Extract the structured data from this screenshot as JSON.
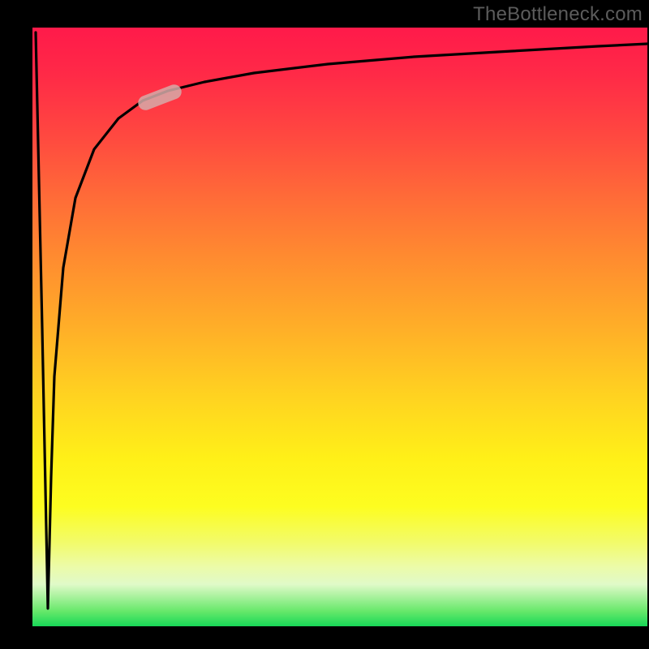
{
  "watermark": "TheBottleneck.com",
  "chart_data": {
    "type": "line",
    "title": "",
    "xlabel": "",
    "ylabel": "",
    "x_range": [
      0,
      100
    ],
    "y_range": [
      0,
      100
    ],
    "grid": false,
    "background_gradient": {
      "stops": [
        {
          "pos": 0.0,
          "color": "#ff1a4a"
        },
        {
          "pos": 0.18,
          "color": "#ff4840"
        },
        {
          "pos": 0.38,
          "color": "#ff8a30"
        },
        {
          "pos": 0.62,
          "color": "#ffd420"
        },
        {
          "pos": 0.8,
          "color": "#fdfd20"
        },
        {
          "pos": 0.93,
          "color": "#e0fac8"
        },
        {
          "pos": 1.0,
          "color": "#18d858"
        }
      ]
    },
    "series": [
      {
        "name": "bottleneck-curve",
        "x": [
          0.5,
          1.5,
          2.5,
          3.0,
          3.5,
          5,
          7,
          10,
          14,
          18,
          22,
          28,
          36,
          48,
          62,
          78,
          92,
          100
        ],
        "y": [
          99,
          50,
          3,
          25,
          42,
          60,
          72,
          80,
          85,
          88,
          89.5,
          91,
          92.5,
          94,
          95.2,
          96.2,
          97,
          97.4
        ],
        "note": "y is percent height from bottom; steep dip near x≈2.5 then asymptote near top"
      }
    ],
    "highlight_segment": {
      "x_start": 18,
      "x_end": 24,
      "y_approx": 88.5
    }
  },
  "colors": {
    "curve": "#000000",
    "highlight": "#d6aaa8",
    "watermark": "#5c5c5c",
    "frame": "#000000"
  }
}
